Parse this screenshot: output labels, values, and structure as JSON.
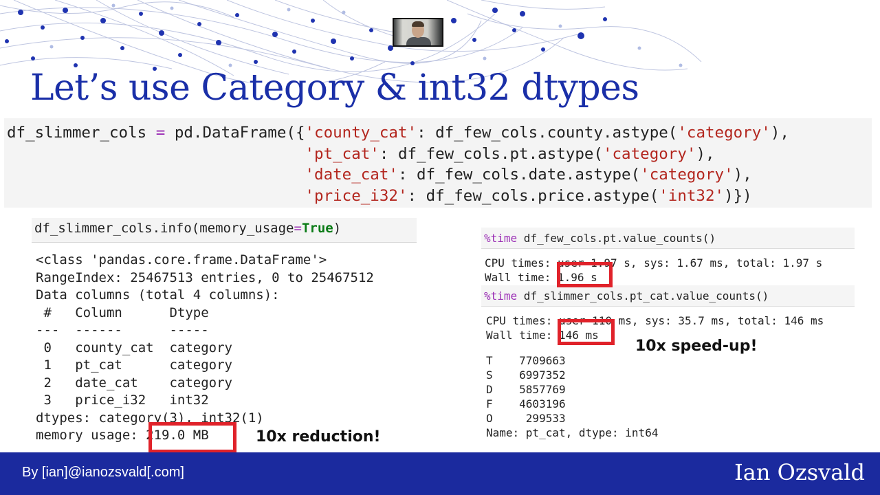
{
  "slide": {
    "title": "Let’s use Category & int32 dtypes",
    "code_main": [
      [
        [
          "t",
          "df_slimmer_cols "
        ],
        [
          "o",
          "="
        ],
        [
          "t",
          " pd.DataFrame({"
        ],
        [
          "s",
          "'county_cat'"
        ],
        [
          "t",
          ": df_few_cols.county.astype("
        ],
        [
          "s",
          "'category'"
        ],
        [
          "t",
          "),"
        ]
      ],
      [
        [
          "t",
          "                                "
        ],
        [
          "s",
          "'pt_cat'"
        ],
        [
          "t",
          ": df_few_cols.pt.astype("
        ],
        [
          "s",
          "'category'"
        ],
        [
          "t",
          "),"
        ]
      ],
      [
        [
          "t",
          "                                "
        ],
        [
          "s",
          "'date_cat'"
        ],
        [
          "t",
          ": df_few_cols.date.astype("
        ],
        [
          "s",
          "'category'"
        ],
        [
          "t",
          "),"
        ]
      ],
      [
        [
          "t",
          "                                "
        ],
        [
          "s",
          "'price_i32'"
        ],
        [
          "t",
          ": df_few_cols.price.astype("
        ],
        [
          "s",
          "'int32'"
        ],
        [
          "t",
          ")})"
        ]
      ]
    ],
    "info_call": {
      "prefix": "df_slimmer_cols.info(memory_usage",
      "eq": "=",
      "kw": "True",
      "suffix": ")"
    },
    "info_output": "<class 'pandas.core.frame.DataFrame'>\nRangeIndex: 25467513 entries, 0 to 25467512\nData columns (total 4 columns):\n #   Column      Dtype   \n---  ------      -----   \n 0   county_cat  category\n 1   pt_cat      category\n 2   date_cat    category\n 3   price_i32   int32   \ndtypes: category(3), int32(1)\nmemory usage: 219.0 MB",
    "time1": {
      "magic": "%time",
      "cmd": " df_few_cols.pt.value_counts()",
      "output": "CPU times: user 1.97 s, sys: 1.67 ms, total: 1.97 s\nWall time: 1.96 s"
    },
    "time2": {
      "magic": "%time",
      "cmd": " df_slimmer_cols.pt_cat.value_counts()",
      "output": "CPU times: user 110 ms, sys: 35.7 ms, total: 146 ms\nWall time: 146 ms"
    },
    "value_counts_output": "T    7709663\nS    6997352\nD    5857769\nF    4603196\nO     299533\nName: pt_cat, dtype: int64",
    "callout_reduction": "10x reduction!",
    "callout_speedup": "10x speed-up!"
  },
  "footer": {
    "by": "By [ian]@ianozsvald[.com]",
    "name": "Ian Ozsvald"
  },
  "colors": {
    "title": "#1a2fa8",
    "footer_bg": "#1b2a9e",
    "highlight_box": "#e0222a",
    "string": "#b3261e",
    "operator": "#9b2fb5",
    "keyword": "#0a7b16"
  }
}
